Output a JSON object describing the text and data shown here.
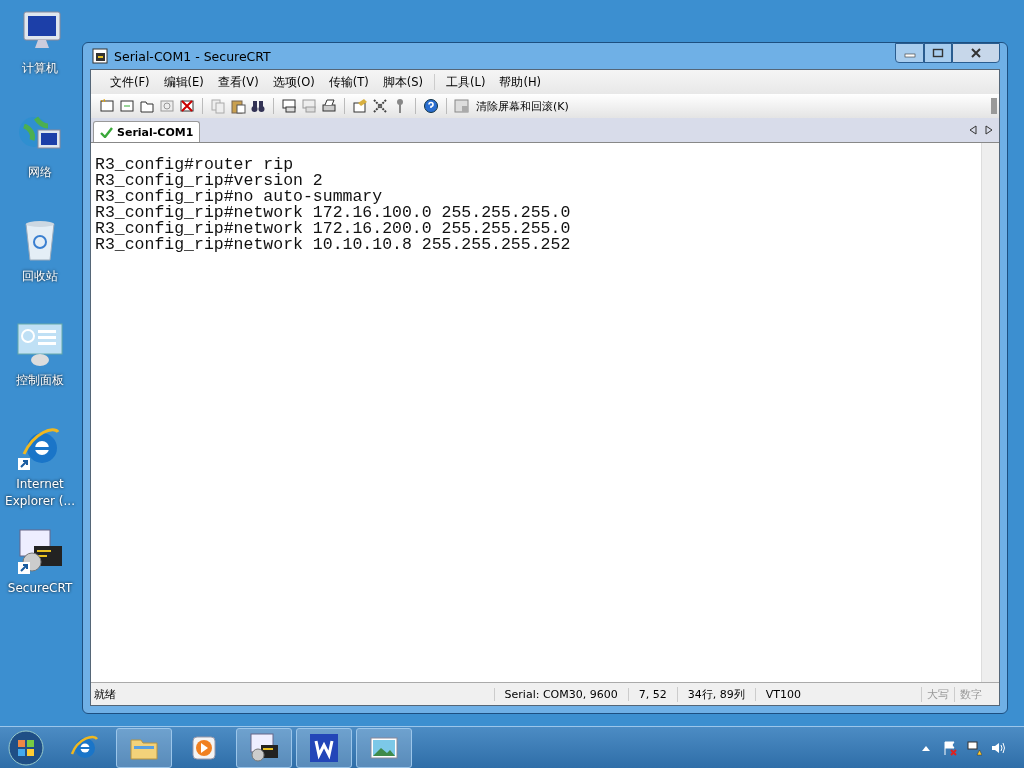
{
  "desktop_icons": [
    {
      "kind": "computer",
      "label": "计算机"
    },
    {
      "kind": "network",
      "label": "网络"
    },
    {
      "kind": "recycle",
      "label": "回收站"
    },
    {
      "kind": "control",
      "label": "控制面板"
    },
    {
      "kind": "ie",
      "label": "Internet Explorer (..."
    },
    {
      "kind": "securecrt",
      "label": "SecureCRT"
    }
  ],
  "window": {
    "title": "Serial-COM1 - SecureCRT",
    "menu": [
      "文件(F)",
      "编辑(E)",
      "查看(V)",
      "选项(O)",
      "传输(T)",
      "脚本(S)",
      "工具(L)",
      "帮助(H)"
    ],
    "toolbar_button": "清除屏幕和回滚(K)",
    "tabs": [
      {
        "label": "Serial-COM1",
        "selected": true
      }
    ],
    "terminal_lines": [
      "R3_config#router rip",
      "R3_config_rip#version 2",
      "R3_config_rip#no auto-summary",
      "R3_config_rip#network 172.16.100.0 255.255.255.0",
      "R3_config_rip#network 172.16.200.0 255.255.255.0",
      "R3_config_rip#network 10.10.10.8 255.255.255.252"
    ],
    "status_bar": {
      "message": "就绪",
      "panes": [
        "Serial: COM30, 9600",
        "7,  52",
        "34行, 89列",
        "VT100"
      ],
      "indicators": [
        {
          "label": "大写",
          "active": false
        },
        {
          "label": "数字",
          "active": false
        }
      ]
    }
  },
  "taskbar": {
    "items": [
      {
        "kind": "explorer",
        "selected": true
      },
      {
        "kind": "media",
        "selected": false
      },
      {
        "kind": "securecrt",
        "selected": true
      },
      {
        "kind": "wps",
        "selected": true
      },
      {
        "kind": "picture",
        "selected": true
      }
    ]
  }
}
